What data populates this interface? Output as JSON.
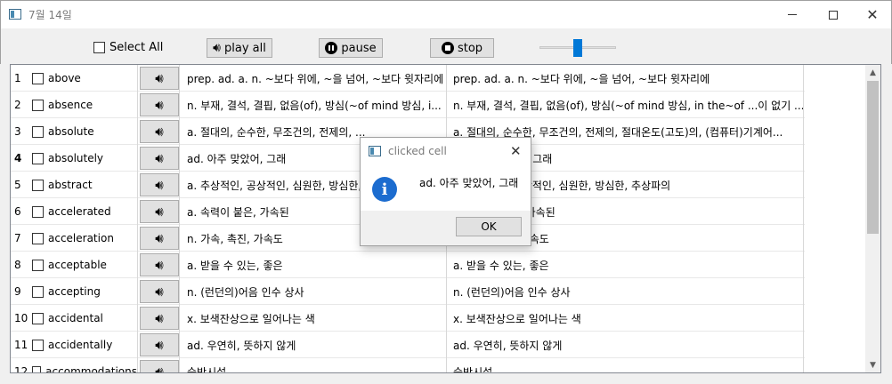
{
  "window": {
    "title": "7월 14일"
  },
  "toolbar": {
    "select_all_label": "Select All",
    "play_all_label": "play all",
    "pause_label": "pause",
    "stop_label": "stop",
    "volume_level": 0.5
  },
  "rows": [
    {
      "num": "1",
      "word": "above",
      "meaning": "prep. ad. a. n. ~보다 위에, ~을 넘어, ~보다 윗자리에",
      "meaning2": "prep. ad. a. n. ~보다 위에, ~을 넘어, ~보다 윗자리에"
    },
    {
      "num": "2",
      "word": "absence",
      "meaning": "n. 부재, 결석, 결핍, 없음(of), 방심(~of mind 방심, i...",
      "meaning2": "n. 부재, 결석, 결핍, 없음(of), 방심(~of mind 방심, in the~of ...이 없기 ..."
    },
    {
      "num": "3",
      "word": "absolute",
      "meaning": "a. 절대의, 순수한, 무조건의, 전제의, ...",
      "meaning2": "a. 절대의, 순수한, 무조건의, 전제의, 절대온도(고도)의, (컴퓨터)기계어..."
    },
    {
      "num": "4",
      "word": "absolutely",
      "meaning": "ad. 아주 맞았어, 그래",
      "meaning2": "ad. 아주 맞았어, 그래"
    },
    {
      "num": "5",
      "word": "abstract",
      "meaning": "a. 추상적인, 공상적인, 심원한, 방심한, 추상파의",
      "meaning2": "a. 추상적인, 공상적인, 심원한, 방심한, 추상파의"
    },
    {
      "num": "6",
      "word": "accelerated",
      "meaning": "a. 속력이 붙은, 가속된",
      "meaning2": "a. 속력이 붙은, 가속된"
    },
    {
      "num": "7",
      "word": "acceleration",
      "meaning": "n. 가속, 촉진, 가속도",
      "meaning2": "n. 가속, 촉진, 가속도"
    },
    {
      "num": "8",
      "word": "acceptable",
      "meaning": "a. 받을 수 있는, 좋은",
      "meaning2": "a. 받을 수 있는, 좋은"
    },
    {
      "num": "9",
      "word": "accepting",
      "meaning": "n. (런던의)어음 인수 상사",
      "meaning2": "n. (런던의)어음 인수 상사"
    },
    {
      "num": "10",
      "word": "accidental",
      "meaning": "x. 보색잔상으로 일어나는 색",
      "meaning2": "x. 보색잔상으로 일어나는 색"
    },
    {
      "num": "11",
      "word": "accidentally",
      "meaning": "ad. 우연히, 뜻하지 않게",
      "meaning2": "ad. 우연히, 뜻하지 않게"
    },
    {
      "num": "12",
      "word": "accommodations",
      "meaning": "숙박시설",
      "meaning2": "숙박시설"
    }
  ],
  "dialog": {
    "title": "clicked cell",
    "message": "ad. 아주 맞았어, 그래",
    "ok_label": "OK"
  }
}
